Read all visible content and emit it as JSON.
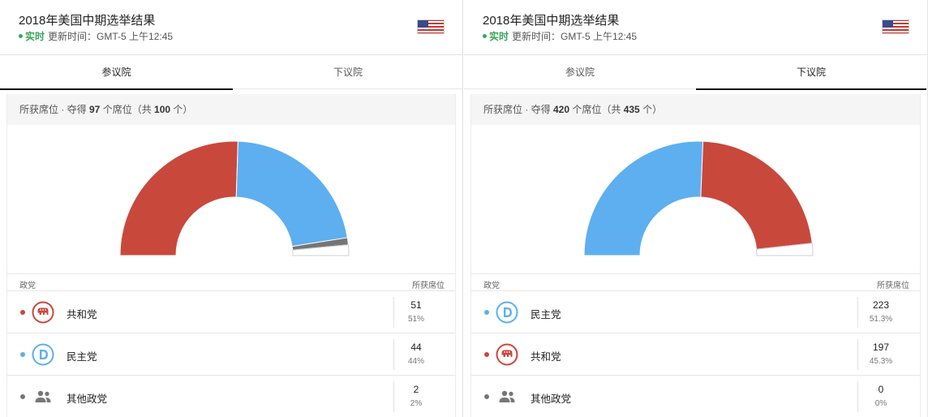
{
  "colors": {
    "republican": "#c9483c",
    "democrat": "#5daff0",
    "other": "#757575",
    "live": "#3aa757"
  },
  "left": {
    "title": "2018年美国中期选举结果",
    "live_label": "实时",
    "updated_text": "更新时间：GMT-5 上午12:45",
    "flag_icon": "us-flag-icon",
    "tabs": [
      {
        "label": "参议院",
        "active": true
      },
      {
        "label": "下议院",
        "active": false
      }
    ],
    "summary_prefix": "所获席位 · 夺得 ",
    "summary_won": "97",
    "summary_mid": " 个席位（共 ",
    "summary_total": "100",
    "summary_suffix": " 个）",
    "col_party": "政党",
    "col_seats": "所获席位",
    "rows": [
      {
        "party": "共和党",
        "seats": "51",
        "pct": "51%",
        "icon": "republican-elephant-icon"
      },
      {
        "party": "民主党",
        "seats": "44",
        "pct": "44%",
        "icon": "democrat-d-icon"
      },
      {
        "party": "其他政党",
        "seats": "2",
        "pct": "2%",
        "icon": "people-icon"
      }
    ]
  },
  "right": {
    "title": "2018年美国中期选举结果",
    "live_label": "实时",
    "updated_text": "更新时间：GMT-5 上午12:45",
    "flag_icon": "us-flag-icon",
    "tabs": [
      {
        "label": "参议院",
        "active": false
      },
      {
        "label": "下议院",
        "active": true
      }
    ],
    "summary_prefix": "所获席位 · 夺得 ",
    "summary_won": "420",
    "summary_mid": " 个席位（共 ",
    "summary_total": "435",
    "summary_suffix": " 个）",
    "col_party": "政党",
    "col_seats": "所获席位",
    "rows": [
      {
        "party": "民主党",
        "seats": "223",
        "pct": "51.3%",
        "icon": "democrat-d-icon"
      },
      {
        "party": "共和党",
        "seats": "197",
        "pct": "45.3%",
        "icon": "republican-elephant-icon"
      },
      {
        "party": "其他政党",
        "seats": "0",
        "pct": "0%",
        "icon": "people-icon"
      }
    ]
  },
  "chart_data": [
    {
      "type": "pie",
      "total": 100,
      "segments": [
        {
          "name": "共和党",
          "value": 51,
          "color": "#c9483c"
        },
        {
          "name": "民主党",
          "value": 44,
          "color": "#5daff0"
        },
        {
          "name": "其他政党",
          "value": 2,
          "color": "#757575"
        }
      ]
    },
    {
      "type": "pie",
      "total": 435,
      "segments": [
        {
          "name": "民主党",
          "value": 223,
          "color": "#5daff0"
        },
        {
          "name": "共和党",
          "value": 197,
          "color": "#c9483c"
        },
        {
          "name": "其他政党",
          "value": 0,
          "color": "#757575"
        }
      ]
    }
  ]
}
